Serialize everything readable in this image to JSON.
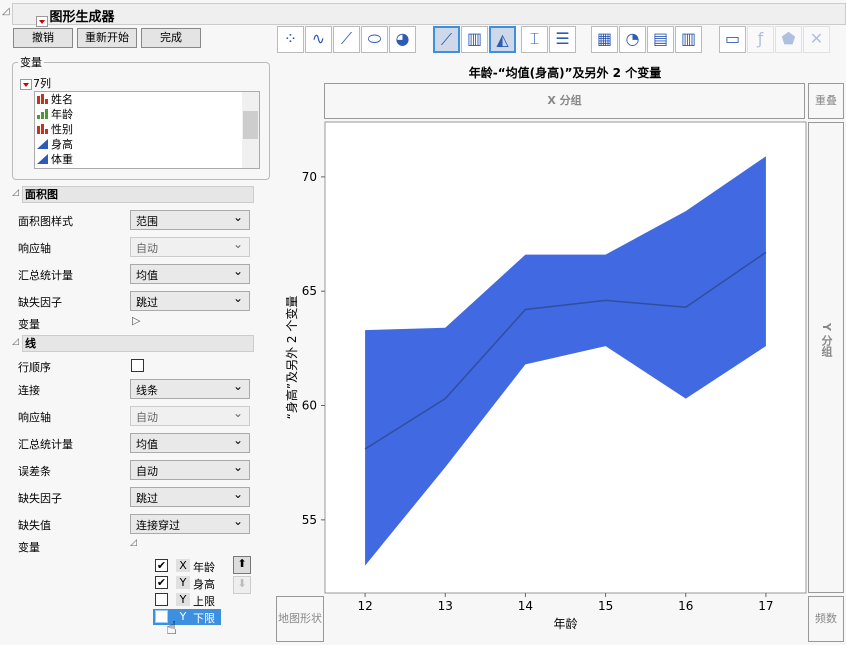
{
  "title": "图形生成器",
  "buttons": {
    "undo": "撤销",
    "restart": "重新开始",
    "done": "完成"
  },
  "variables": {
    "group_label": "变量",
    "columns_label": "7列",
    "items": [
      {
        "name": "姓名",
        "type": "nominal"
      },
      {
        "name": "年龄",
        "type": "ordinal"
      },
      {
        "name": "性别",
        "type": "nominal"
      },
      {
        "name": "身高",
        "type": "continuous"
      },
      {
        "name": "体重",
        "type": "continuous"
      }
    ]
  },
  "area": {
    "header": "面积图",
    "rows": [
      {
        "label": "面积图样式",
        "value": "范围"
      },
      {
        "label": "响应轴",
        "value": "自动"
      },
      {
        "label": "汇总统计量",
        "value": "均值"
      },
      {
        "label": "缺失因子",
        "value": "跳过"
      }
    ],
    "variables_label": "变量"
  },
  "line": {
    "header": "线",
    "order_label": "行顺序",
    "rows": [
      {
        "label": "连接",
        "value": "线条"
      },
      {
        "label": "响应轴",
        "value": "自动"
      },
      {
        "label": "汇总统计量",
        "value": "均值"
      },
      {
        "label": "误差条",
        "value": "自动"
      },
      {
        "label": "缺失因子",
        "value": "跳过"
      },
      {
        "label": "缺失值",
        "value": "连接穿过"
      }
    ],
    "variables_label": "变量",
    "var_list": [
      {
        "role": "X",
        "name": "年龄",
        "checked": true
      },
      {
        "role": "Y",
        "name": "身高",
        "checked": true
      },
      {
        "role": "Y",
        "name": "上限",
        "checked": false
      },
      {
        "role": "Y",
        "name": "下限",
        "checked": false
      }
    ]
  },
  "zones": {
    "x_group": "X 分组",
    "overlay": "重叠",
    "y_group": "Y 分组",
    "map_shape": "地图形状",
    "freq": "频数"
  },
  "chart_data": {
    "type": "area",
    "title": "年龄-“均值(身高)”及另外 2 个变量",
    "xlabel": "年龄",
    "ylabel": "“身高”及另外 2 个变量",
    "x": [
      12,
      13,
      14,
      15,
      16,
      17
    ],
    "series": [
      {
        "name": "上限",
        "values": [
          63.3,
          63.4,
          66.6,
          66.6,
          68.5,
          70.9
        ]
      },
      {
        "name": "下限",
        "values": [
          53.0,
          57.3,
          61.8,
          62.6,
          60.3,
          62.6
        ]
      },
      {
        "name": "均值(身高)",
        "values": [
          58.1,
          60.3,
          64.2,
          64.6,
          64.3,
          66.7
        ]
      }
    ],
    "yticks": [
      55,
      60,
      65,
      70
    ],
    "xlim": [
      11.5,
      17.5
    ],
    "ylim": [
      51.8,
      72.4
    ],
    "fill_color": "#4169e1",
    "line_color": "#2f4f9f"
  }
}
